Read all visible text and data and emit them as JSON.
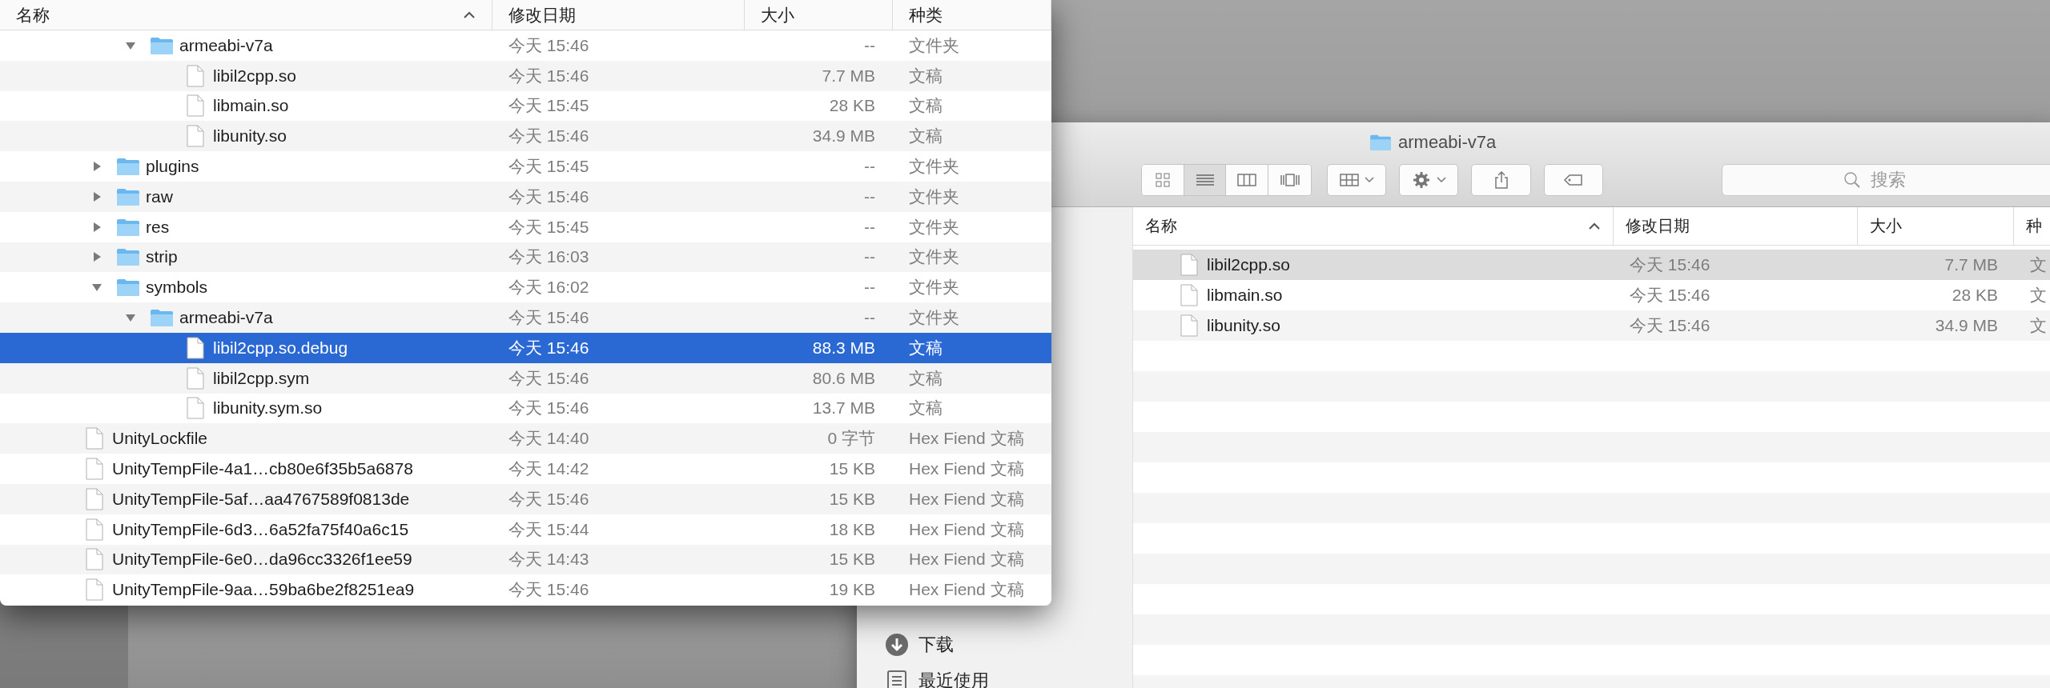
{
  "left_window": {
    "columns": [
      {
        "label": "名称",
        "sort_ascending": true
      },
      {
        "label": "修改日期"
      },
      {
        "label": "大小"
      },
      {
        "label": "种类"
      }
    ],
    "rows": [
      {
        "children": [
          {
            "children": [
              {
                "name": "armeabi-v7a",
                "date": "今天 15:46",
                "size": "--",
                "type": "文件夹",
                "kind": "folder",
                "expanded": true,
                "selected": false,
                "children": [
                  {
                    "name": "libil2cpp.so",
                    "date": "今天 15:46",
                    "size": "7.7 MB",
                    "type": "文稿",
                    "kind": "file",
                    "selected": false
                  },
                  {
                    "name": "libmain.so",
                    "date": "今天 15:45",
                    "size": "28 KB",
                    "type": "文稿",
                    "kind": "file",
                    "selected": false
                  },
                  {
                    "name": "libunity.so",
                    "date": "今天 15:46",
                    "size": "34.9 MB",
                    "type": "文稿",
                    "kind": "file",
                    "selected": false
                  }
                ]
              }
            ]
          },
          {
            "name": "plugins",
            "date": "今天 15:45",
            "size": "--",
            "type": "文件夹",
            "kind": "folder",
            "expanded": false,
            "selected": false
          },
          {
            "name": "raw",
            "date": "今天 15:46",
            "size": "--",
            "type": "文件夹",
            "kind": "folder",
            "expanded": false,
            "selected": false
          },
          {
            "name": "res",
            "date": "今天 15:45",
            "size": "--",
            "type": "文件夹",
            "kind": "folder",
            "expanded": false,
            "selected": false
          },
          {
            "name": "strip",
            "date": "今天 16:03",
            "size": "--",
            "type": "文件夹",
            "kind": "folder",
            "expanded": false,
            "selected": false
          },
          {
            "name": "symbols",
            "date": "今天 16:02",
            "size": "--",
            "type": "文件夹",
            "kind": "folder",
            "expanded": true,
            "selected": false,
            "children": [
              {
                "name": "armeabi-v7a",
                "date": "今天 15:46",
                "size": "--",
                "type": "文件夹",
                "kind": "folder",
                "expanded": true,
                "selected": false,
                "children": [
                  {
                    "name": "libil2cpp.so.debug",
                    "date": "今天 15:46",
                    "size": "88.3 MB",
                    "type": "文稿",
                    "kind": "file",
                    "selected": true
                  },
                  {
                    "name": "libil2cpp.sym",
                    "date": "今天 15:46",
                    "size": "80.6 MB",
                    "type": "文稿",
                    "kind": "file",
                    "selected": false
                  },
                  {
                    "name": "libunity.sym.so",
                    "date": "今天 15:46",
                    "size": "13.7 MB",
                    "type": "文稿",
                    "kind": "file",
                    "selected": false
                  }
                ]
              }
            ]
          }
        ]
      },
      {
        "name": "UnityLockfile",
        "date": "今天 14:40",
        "size": "0 字节",
        "type": "Hex Fiend 文稿",
        "kind": "file",
        "selected": false
      },
      {
        "name": "UnityTempFile-4a1…cb80e6f35b5a6878",
        "date": "今天 14:42",
        "size": "15 KB",
        "type": "Hex Fiend 文稿",
        "kind": "file",
        "selected": false
      },
      {
        "name": "UnityTempFile-5af…aa4767589f0813de",
        "date": "今天 15:46",
        "size": "15 KB",
        "type": "Hex Fiend 文稿",
        "kind": "file",
        "selected": false
      },
      {
        "name": "UnityTempFile-6d3…6a52fa75f40a6c15",
        "date": "今天 15:44",
        "size": "18 KB",
        "type": "Hex Fiend 文稿",
        "kind": "file",
        "selected": false
      },
      {
        "name": "UnityTempFile-6e0…da96cc3326f1ee59",
        "date": "今天 14:43",
        "size": "15 KB",
        "type": "Hex Fiend 文稿",
        "kind": "file",
        "selected": false
      },
      {
        "name": "UnityTempFile-9aa…59ba6be2f8251ea9",
        "date": "今天 15:46",
        "size": "19 KB",
        "type": "Hex Fiend 文稿",
        "kind": "file",
        "selected": false
      }
    ]
  },
  "right_window": {
    "title": "armeabi-v7a",
    "view_modes": [
      {
        "kind": "icons",
        "selected": false
      },
      {
        "kind": "list",
        "selected": true
      },
      {
        "kind": "columns",
        "selected": false
      },
      {
        "kind": "cover",
        "selected": false
      }
    ],
    "search": {
      "placeholder": "搜索"
    },
    "sidebar": [
      {
        "label": "下载",
        "kind": "download"
      },
      {
        "label": "最近使用",
        "kind": "recent"
      }
    ],
    "columns": [
      {
        "label": "名称",
        "sort_ascending": true
      },
      {
        "label": "修改日期"
      },
      {
        "label": "大小"
      },
      {
        "label": "种"
      }
    ],
    "rows": [
      {
        "name": "libil2cpp.so",
        "date": "今天 15:46",
        "size": "7.7 MB",
        "type": "文",
        "kind": "file",
        "selected": true
      },
      {
        "name": "libmain.so",
        "date": "今天 15:46",
        "size": "28 KB",
        "type": "文",
        "kind": "file",
        "selected": false
      },
      {
        "name": "libunity.so",
        "date": "今天 15:46",
        "size": "34.9 MB",
        "type": "文",
        "kind": "file",
        "selected": false
      }
    ]
  }
}
